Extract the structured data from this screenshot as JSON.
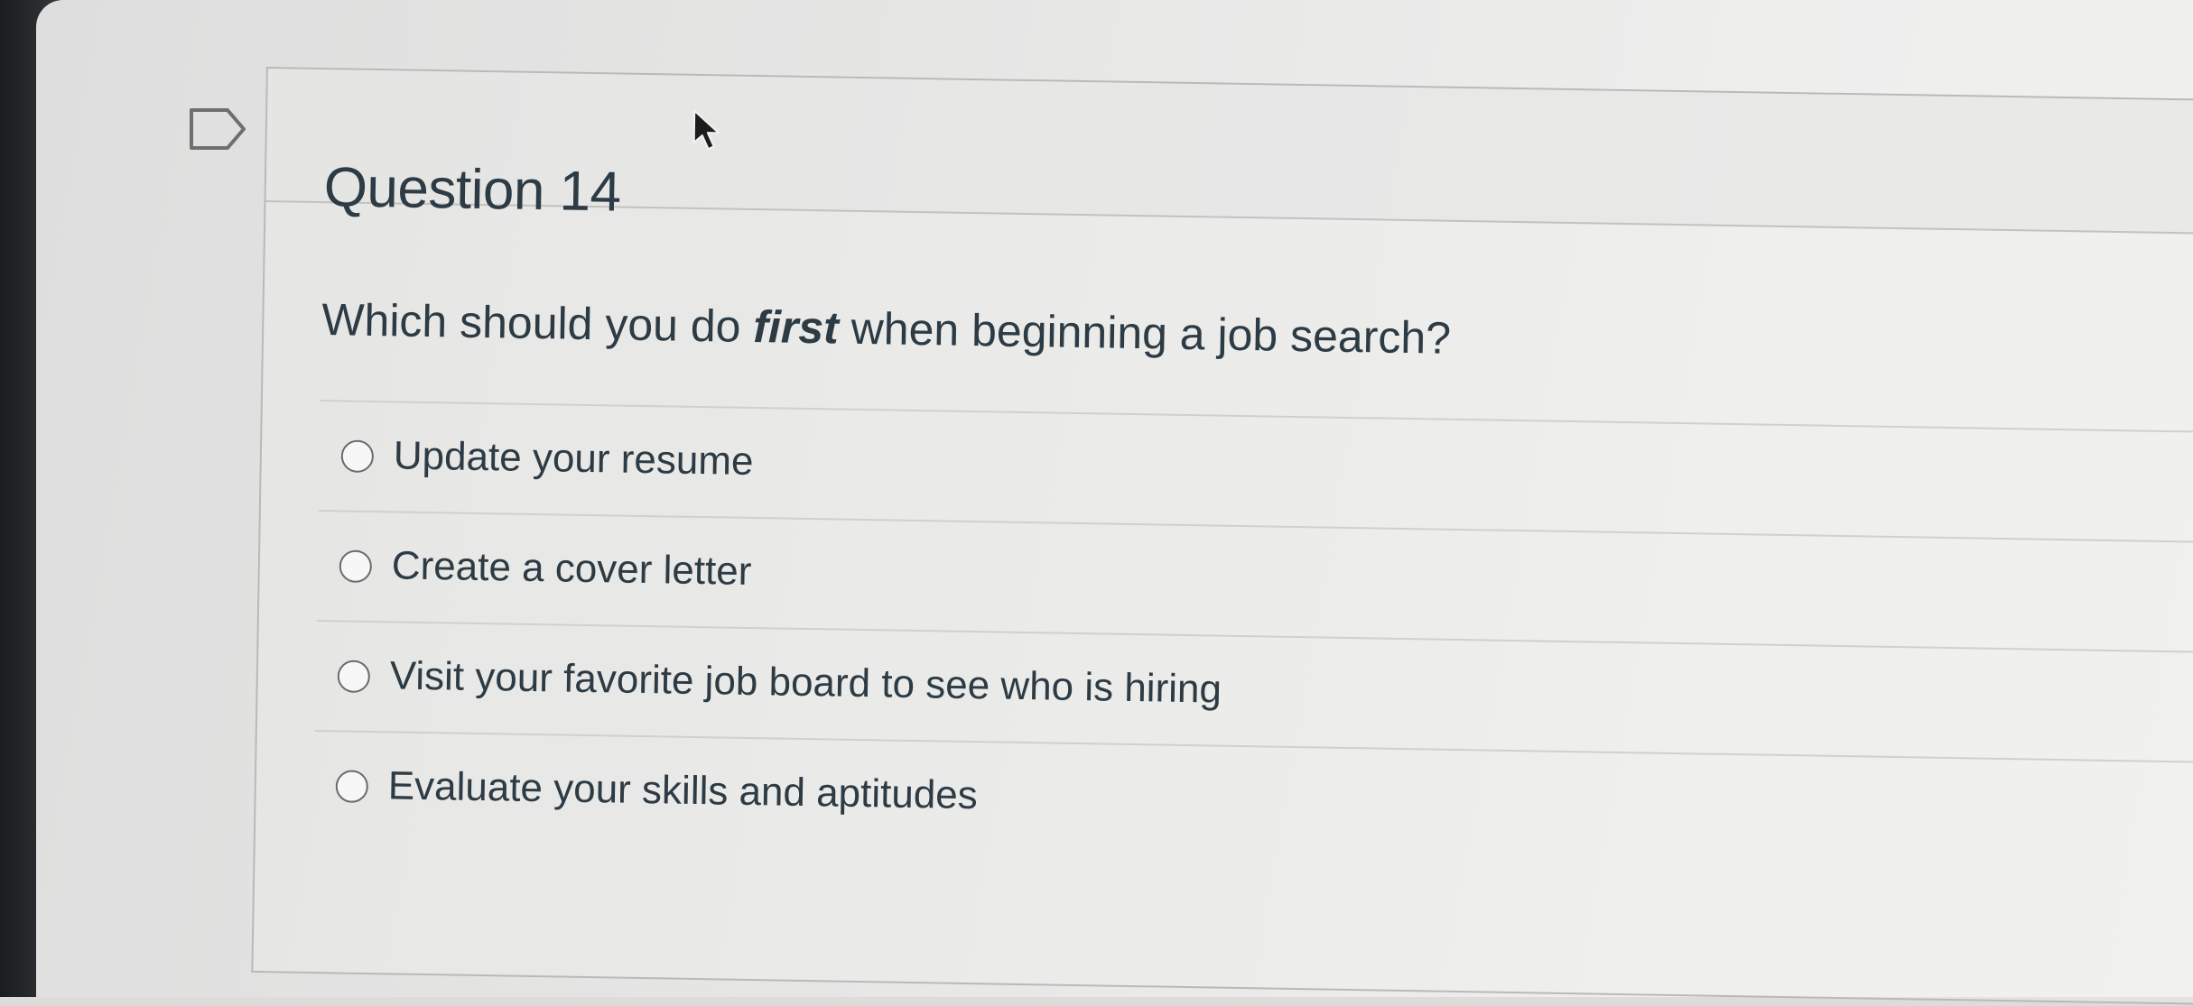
{
  "question": {
    "title": "Question 14",
    "text_before": "Which should you do ",
    "text_emphasis": "first",
    "text_after": " when beginning a job search?",
    "answers": [
      {
        "label": "Update your resume",
        "selected": false
      },
      {
        "label": "Create a cover letter",
        "selected": false
      },
      {
        "label": "Visit your favorite job board to see who is hiring",
        "selected": false
      },
      {
        "label": "Evaluate your skills and aptitudes",
        "selected": false
      }
    ]
  },
  "icons": {
    "flag": "flag-question-icon",
    "cursor": "mouse-pointer-icon",
    "radio": "radio-button-icon"
  },
  "colors": {
    "text": "#2d3b45",
    "border": "#b9b9b8",
    "divider": "#d0d0cf",
    "radio_border": "#6b6b6b"
  }
}
